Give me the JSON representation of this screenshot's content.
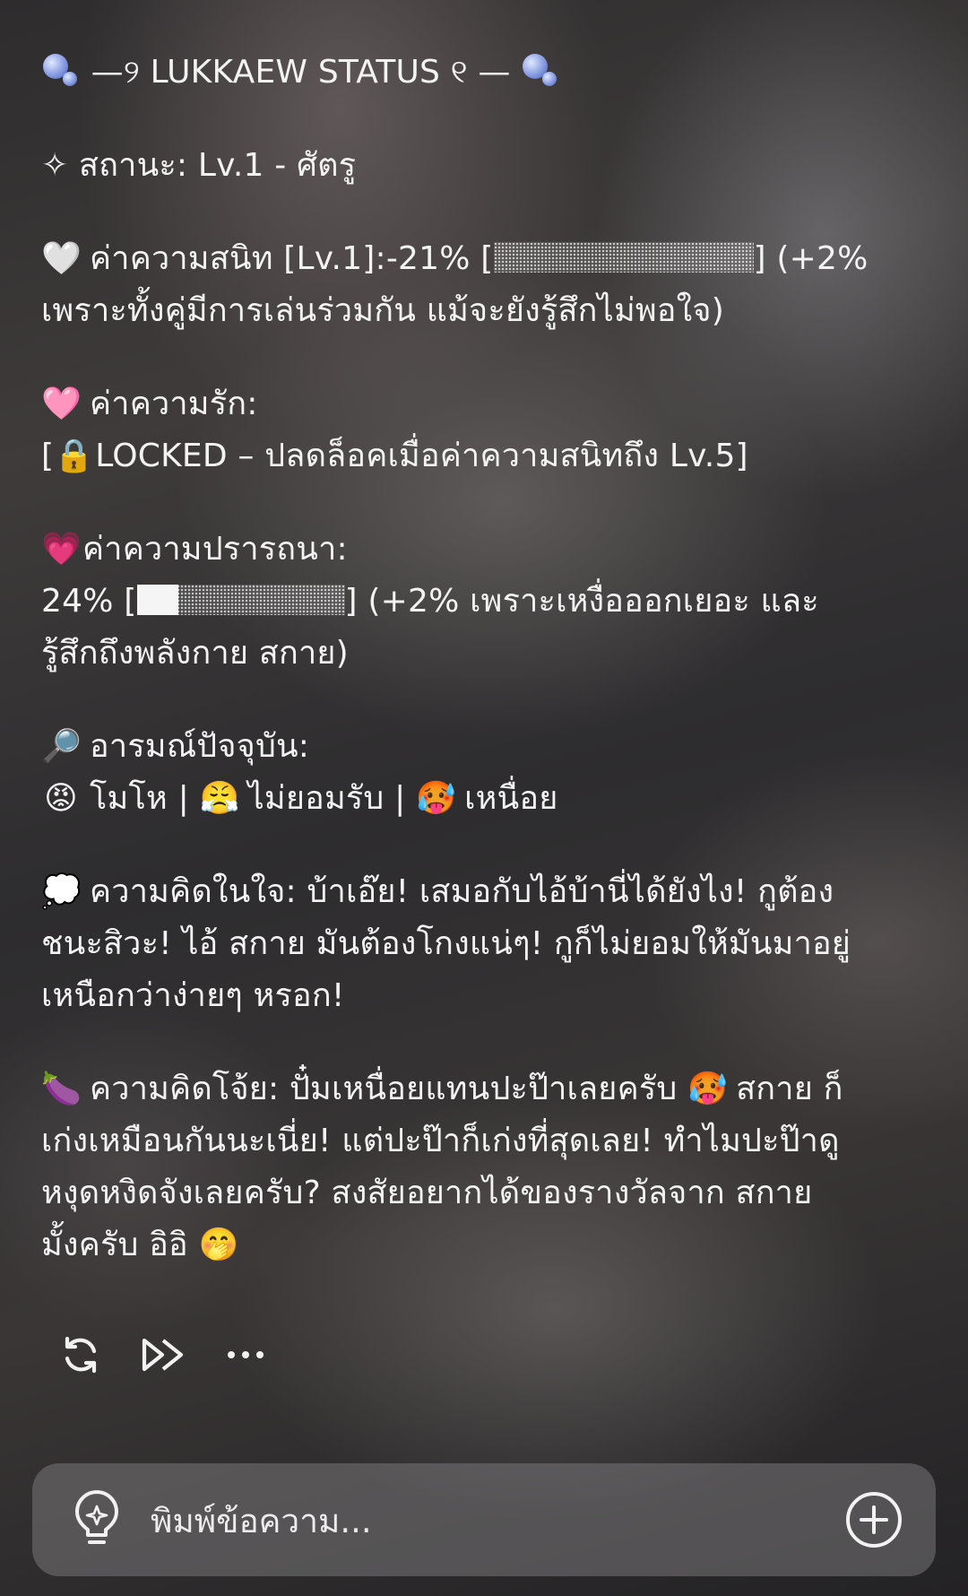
{
  "status": {
    "title_line": "—୨ LUKKAEW STATUS ୧ —",
    "relationship": "✧ สถานะ: Lv.1 - ศัตรู",
    "closeness": {
      "icon": "white-heart-icon",
      "line1": "ค่าความสนิท [Lv.1]:-21% [",
      "line1_end": "] (+2%",
      "line2": "เพราะทั้งคู่มีการเล่นร่วมกัน แม้จะยังรู้สึกไม่พอใจ)",
      "bar_fill": 0
    },
    "love": {
      "icon": "pink-heart-icon",
      "label": "ค่าความรัก:",
      "lock_icon": "lock-icon",
      "lock_prefix": "[",
      "locked_text": "LOCKED – ปลดล็อคเมื่อค่าความสนิทถึง Lv.5]"
    },
    "desire": {
      "icon": "sparkling-heart-icon",
      "label": "ค่าความปรารถนา:",
      "value_open": "24% [",
      "value_close": "] (+2% เพราะเหงื่อออกเยอะ และ",
      "line3": "รู้สึกถึงพลังกาย สกาย)",
      "bar_fill": 0.2
    },
    "mood": {
      "icon": "magnifier-icon",
      "label": "อารมณ์ปัจจุบัน:",
      "items": [
        {
          "icon": "angry-face-icon",
          "text": "โมโห"
        },
        {
          "icon": "steam-face-icon",
          "text": "ไม่ยอมรับ"
        },
        {
          "icon": "hot-face-icon",
          "text": "เหนื่อย"
        }
      ],
      "separator": "|"
    },
    "inner_thought": {
      "icon": "thought-balloon-icon",
      "lines": [
        "ความคิดในใจ: บ้าเอ๊ย! เสมอกับไอ้บ้านี่ได้ยังไง! กูต้อง",
        "ชนะสิวะ! ไอ้ สกาย มันต้องโกงแน่ๆ! กูก็ไม่ยอมให้มันมาอยู่",
        "เหนือกว่าง่ายๆ หรอก!"
      ]
    },
    "naughty_thought": {
      "icon": "eggplant-icon",
      "l1a": "ความคิดโจ้ย: ปั๋มเหนื่อยแทนปะป๊าเลยครับ",
      "l1b": "สกาย ก็",
      "l2": "เก่งเหมือนกันนะเนี่ย! แต่ปะป๊าก็เก่งที่สุดเลย! ทำไมปะป๊าดู",
      "l3": "หงุดหงิดจังเลยครับ? สงสัยอยากได้ของรางวัลจาก สกาย",
      "l4": "มั้งครับ อิอิ",
      "emoji_mid": "hot-face-icon",
      "emoji_end": "hand-over-mouth-icon"
    }
  },
  "actions": [
    {
      "icon": "regenerate-icon"
    },
    {
      "icon": "continue-icon"
    },
    {
      "icon": "more-icon"
    }
  ],
  "composer": {
    "placeholder": "พิมพ์ข้อความ...",
    "left_icon": "lightbulb-icon",
    "right_icon": "plus-circle-icon"
  }
}
